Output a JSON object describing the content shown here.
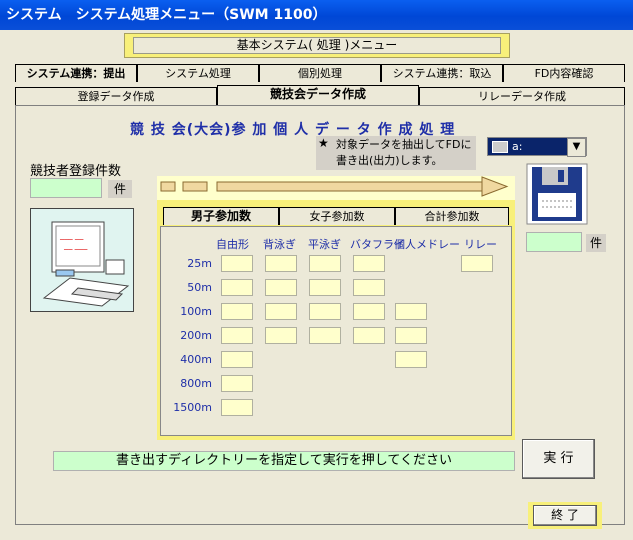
{
  "window": {
    "title": "システム　システム処理メニュー（SWM 1100）"
  },
  "header": {
    "title": "基本システム( 処理 )メニュー"
  },
  "main_tabs": [
    "システム連携：提出",
    "システム処理",
    "個別処理",
    "システム連携：取込",
    "FD内容確認"
  ],
  "sub_tabs": [
    "登録データ作成",
    "競技会データ作成",
    "リレーデータ作成"
  ],
  "section": {
    "title": "競 技 会(大会)参 加 個 人 デ ー タ 作 成 処 理",
    "note_line1": "対象データを抽出してFDに",
    "note_line2": "書き出(出力)します。",
    "note_star": "★",
    "count_label": "競技者登録件数",
    "count_unit": "件",
    "fd_count_unit": "件",
    "drive_value": "a:"
  },
  "entry_tabs": [
    "男子参加数",
    "女子参加数",
    "合計参加数"
  ],
  "grid": {
    "columns": [
      "自由形",
      "背泳ぎ",
      "平泳ぎ",
      "バタフライ",
      "個人メドレー",
      "リレー"
    ],
    "rows": [
      "25m",
      "50m",
      "100m",
      "200m",
      "400m",
      "800m",
      "1500m"
    ]
  },
  "status": {
    "message": "書き出すディレクトリーを指定して実行を押してください"
  },
  "buttons": {
    "execute": "実 行",
    "exit": "終 了"
  }
}
